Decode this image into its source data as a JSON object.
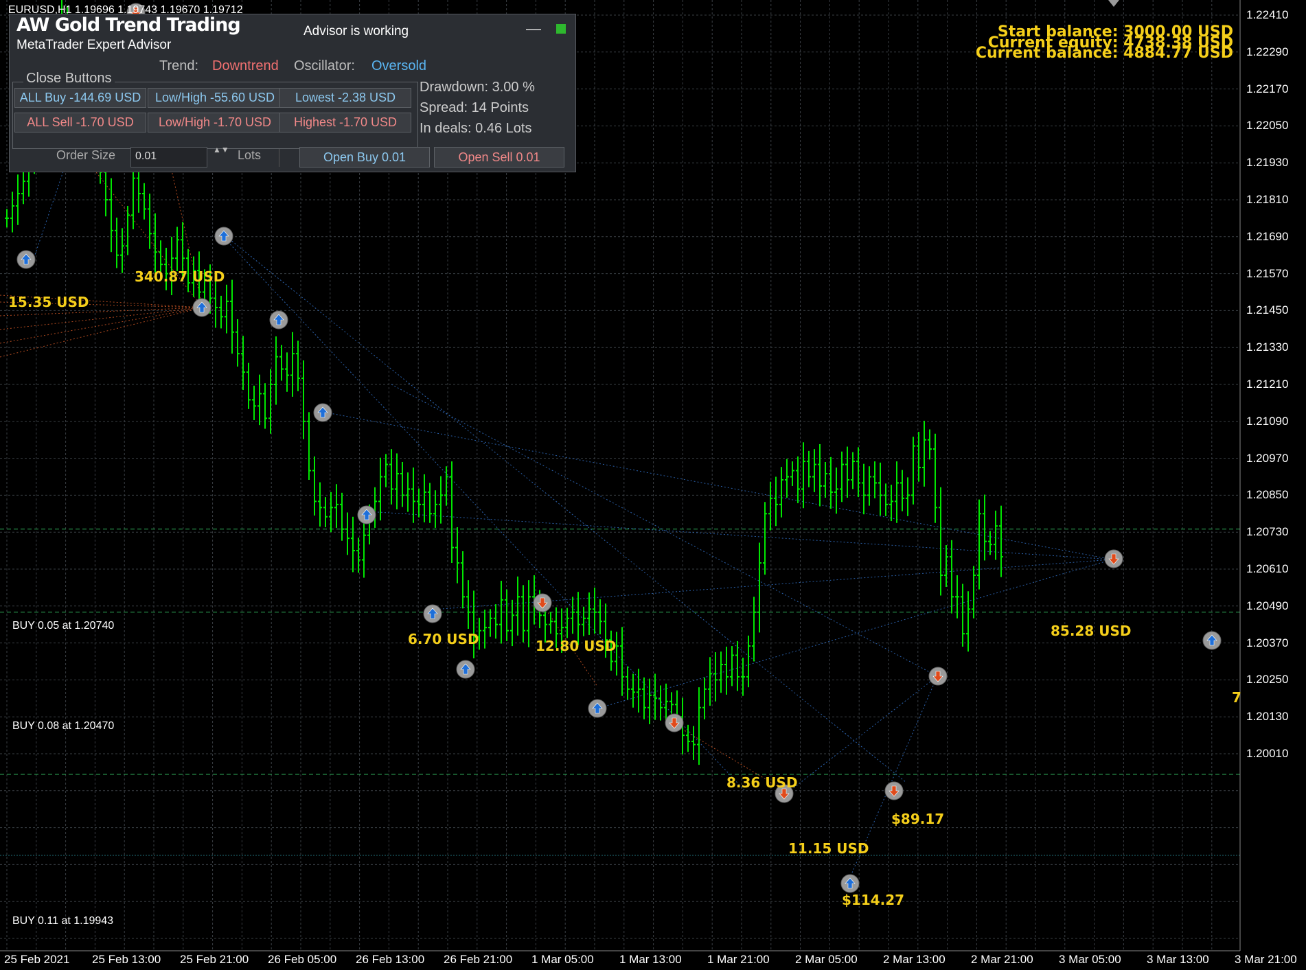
{
  "chart_header": "EURUSD,H1  1.19696 1.19743 1.19670 1.19712",
  "panel": {
    "title": "AW Gold Trend Trading",
    "subtitle": "MetaTrader Expert Advisor",
    "status": "Advisor is working",
    "minimize": "—",
    "trend_label": "Trend:",
    "trend_value": "Downtrend",
    "oscillator_label": "Oscillator:",
    "oscillator_value": "Oversold",
    "group_label": "Close Buttons",
    "buttons": {
      "all_buy": "ALL Buy -144.69 USD",
      "low_high_buy": "Low/High -55.60 USD",
      "lowest": "Lowest -2.38 USD",
      "all_sell": "ALL Sell -1.70 USD",
      "low_high_sell": "Low/High -1.70 USD",
      "highest": "Highest -1.70 USD"
    },
    "drawdown": "Drawdown: 3.00 %",
    "spread": "Spread: 14 Points",
    "in_deals": "In deals: 0.46 Lots",
    "order_size_label": "Order Size",
    "order_size_value": "0.01",
    "spinner": "▲▼",
    "lots_label": "Lots",
    "open_buy": "Open Buy 0.01",
    "open_sell": "Open Sell 0.01"
  },
  "balance": {
    "start": "Start balance: 3000.00 USD",
    "equity": "Current equity: 4738.38  USD",
    "current": "Current balance: 4884.77  USD"
  },
  "trade_lines": [
    {
      "label": "BUY 0.05 at 1.20740",
      "price": 1.2074
    },
    {
      "label": "BUY 0.08 at 1.20470",
      "price": 1.2047
    },
    {
      "label": "BUY 0.11 at 1.19943",
      "price": 1.19943
    }
  ],
  "profit_labels": [
    {
      "text": "15.35 USD"
    },
    {
      "text": "340.87 USD"
    },
    {
      "text": "6.70 USD"
    },
    {
      "text": "12.80 USD"
    },
    {
      "text": "8.36 USD"
    },
    {
      "text": "11.15 USD"
    },
    {
      "text": "$114.27"
    },
    {
      "text": "$89.17"
    },
    {
      "text": "85.28 USD"
    },
    {
      "text": "7"
    }
  ],
  "price_ticks": [
    "1.22410",
    "1.22290",
    "1.22170",
    "1.22050",
    "1.21930",
    "1.21810",
    "1.21690",
    "1.21570",
    "1.21450",
    "1.21330",
    "1.21210",
    "1.21090",
    "1.20970",
    "1.20850",
    "1.20730",
    "1.20610",
    "1.20490",
    "1.20370",
    "1.20250",
    "1.20130",
    "1.20010"
  ],
  "time_ticks": [
    "25 Feb 2021",
    "25 Feb 13:00",
    "25 Feb 21:00",
    "26 Feb 05:00",
    "26 Feb 13:00",
    "26 Feb 21:00",
    "1 Mar 05:00",
    "1 Mar 13:00",
    "1 Mar 21:00",
    "2 Mar 05:00",
    "2 Mar 13:00",
    "2 Mar 21:00",
    "3 Mar 05:00",
    "3 Mar 13:00",
    "3 Mar 21:00"
  ],
  "colors": {
    "background": "#000000",
    "grid": "#3a3f44",
    "bars": "#00e600",
    "buy_arrow": "#1e6fd9",
    "sell_arrow": "#e04a1a",
    "text_accent": "#f5cf1a"
  },
  "chart_data": {
    "type": "ohlc",
    "symbol": "EURUSD",
    "timeframe": "H1",
    "ylim": [
      1.1994,
      1.2247
    ],
    "closes": [
      1.2175,
      1.2179,
      1.2183,
      1.2187,
      1.2196,
      1.2203,
      1.221,
      1.222,
      1.2229,
      1.2237,
      1.2241,
      1.2235,
      1.2228,
      1.2219,
      1.2211,
      1.2205,
      1.2198,
      1.219,
      1.2181,
      1.2171,
      1.2163,
      1.2166,
      1.2176,
      1.2188,
      1.2183,
      1.2178,
      1.217,
      1.2164,
      1.216,
      1.2157,
      1.2162,
      1.2168,
      1.2162,
      1.2154,
      1.2158,
      1.2151,
      1.2155,
      1.2149,
      1.2146,
      1.2143,
      1.2148,
      1.2138,
      1.2131,
      1.2125,
      1.2116,
      1.2114,
      1.2118,
      1.211,
      1.2121,
      1.213,
      1.2126,
      1.2124,
      1.2131,
      1.2123,
      1.2109,
      1.2093,
      1.2083,
      1.2081,
      1.2078,
      1.2081,
      1.2082,
      1.2074,
      1.2071,
      1.2067,
      1.2064,
      1.2072,
      1.2079,
      1.2083,
      1.2091,
      1.2095,
      1.2087,
      1.2092,
      1.2085,
      1.2087,
      1.2083,
      1.2082,
      1.2086,
      1.2079,
      1.2082,
      1.2085,
      1.2091,
      1.2068,
      1.2063,
      1.2052,
      1.2047,
      1.2039,
      1.2041,
      1.2042,
      1.2045,
      1.2043,
      1.2051,
      1.2041,
      1.2046,
      1.2052,
      1.2041,
      1.2052,
      1.205,
      1.2046,
      1.2043,
      1.2044,
      1.204,
      1.2042,
      1.2045,
      1.2047,
      1.2043,
      1.2045,
      1.2048,
      1.2047,
      1.2044,
      1.2038,
      1.2031,
      1.2036,
      1.2026,
      1.2022,
      1.2021,
      1.2022,
      1.2016,
      1.202,
      1.2019,
      1.2016,
      1.2018,
      1.2017,
      1.2013,
      1.2007,
      1.2005,
      1.2004,
      1.2016,
      1.2022,
      1.2027,
      1.2025,
      1.203,
      1.2026,
      1.2033,
      1.2026,
      1.2026,
      1.2036,
      1.2047,
      1.2063,
      1.2079,
      1.2084,
      1.2082,
      1.209,
      1.2091,
      1.2093,
      1.2087,
      1.2096,
      1.2091,
      1.2095,
      1.2088,
      1.2092,
      1.2086,
      1.2087,
      1.2095,
      1.209,
      1.2096,
      1.2089,
      1.2085,
      1.2091,
      1.2089,
      1.2085,
      1.2082,
      1.2083,
      1.2089,
      1.2084,
      1.2085,
      1.2101,
      1.2094,
      1.2103,
      1.21,
      1.2081,
      1.2059,
      1.2065,
      1.2052,
      1.2052,
      1.204,
      1.2048,
      1.2059,
      1.2079,
      1.207,
      1.2069,
      1.2075,
      1.2065
    ],
    "series": [
      {
        "name": "EURUSD,H1"
      }
    ]
  }
}
